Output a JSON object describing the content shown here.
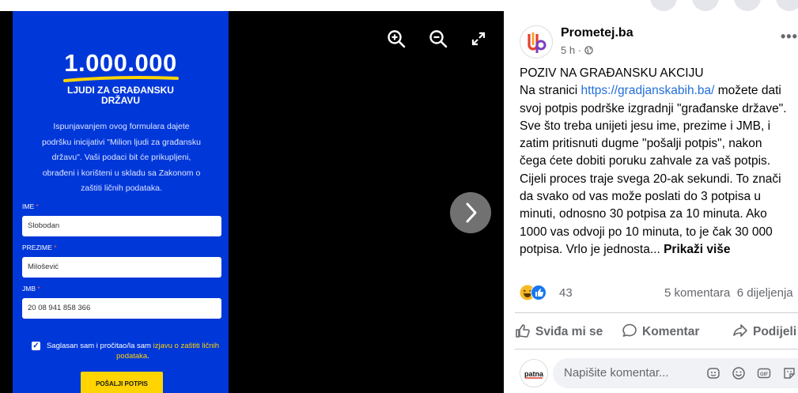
{
  "viewer": {
    "zoom_in_icon": "zoom-in-icon",
    "zoom_out_icon": "zoom-out-icon",
    "fullscreen_icon": "fullscreen-icon",
    "next_icon": "chevron-right-icon",
    "poster": {
      "big_number": "1.000.000",
      "subtitle_line1": "LJUDI ZA GRAĐANSKU",
      "subtitle_line2": "DRŽAVU",
      "intro_lines": [
        "Ispunjavanjem ovog formulara  dajete",
        "podršku inicijativi \"Milion ljudi za građansku",
        "državu\". Vaši podaci bit će prikupljeni,",
        "obrađeni i korišteni u skladu sa Zakonom o",
        "zaštiti ličnih podataka."
      ],
      "fields": [
        {
          "label": "IME",
          "value": "Slobodan"
        },
        {
          "label": "PREZIME",
          "value": "Milošević"
        },
        {
          "label": "JMB",
          "value": "20 08 941 858 366"
        }
      ],
      "required_mark": "*",
      "consent_text": "Saglasan sam i pročitao/la sam ",
      "consent_link": "izjavu o zaštiti ličnih podataka",
      "consent_period": ".",
      "consent_checked": true,
      "submit_label": "POŠALJI POTPIS",
      "colors": {
        "background": "#0037d9",
        "accent": "#ffd400"
      }
    }
  },
  "post": {
    "page_name": "Prometej.ba",
    "time": "5 h",
    "dot": "·",
    "audience_icon": "globe-icon",
    "more_icon": "more-horizontal-icon",
    "more_label": "•••",
    "text_lines": [
      "POZIV NA GRAĐANSKU AKCIJU",
      "svoj potpis podrške izgradnji \"građanske države\".",
      "Sve što treba unijeti jesu ime, prezime i JMB, i",
      "zatim pritisnuti dugme \"pošalji potpis\", nakon",
      "čega ćete dobiti poruku zahvale za vaš potpis.",
      "Cijeli proces traje svega 20-ak sekundi. To znači",
      "da svako od vas može poslati do 3 potpisa u",
      "minuti, odnosno 30 potpisa za 10 minuta. Ako",
      "1000 vas odvoji po 10 minuta, to je čak 30 000",
      "potpisa. Vrlo je jednosta..."
    ],
    "link_prefix": "Na stranici ",
    "link": "https://gradjanskabih.ba/",
    "link_suffix": " možete dati",
    "see_more": "Prikaži više",
    "reaction_count": "43",
    "comments_label": "5 komentara",
    "shares_label": "6 dijeljenja",
    "actions": {
      "like": "Sviđa mi se",
      "comment": "Komentar",
      "share": "Podijeli"
    },
    "comment_placeholder": "Napišite komentar...",
    "comment_avatar_text": "patna",
    "colors": {
      "link": "#216fdb",
      "muted": "#65676b",
      "like_blue": "#1877f2",
      "haha_yellow": "#f7b928"
    }
  }
}
